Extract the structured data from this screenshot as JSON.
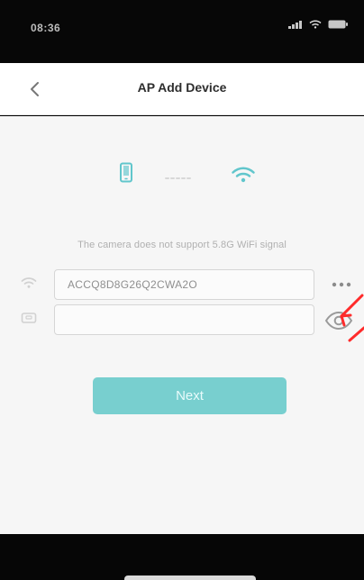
{
  "status_bar": {
    "time": "08:36",
    "location_icon": "location-arrow-icon",
    "signal_icon": "cellular-signal-icon",
    "wifi_icon": "wifi-icon",
    "battery_icon": "battery-icon"
  },
  "header": {
    "title": "AP Add Device",
    "back_icon": "chevron-left-icon"
  },
  "steps": {
    "icons": [
      "phone-icon",
      "dash-icon",
      "wifi-icon"
    ]
  },
  "form": {
    "notice": "The camera does not support 5.8G WiFi signal",
    "wifi_name": {
      "value": "ACCQ8D8G26Q2CWA2O",
      "icon": "wifi-icon",
      "more_icon": "more-dots-icon"
    },
    "password": {
      "value": "",
      "icon": "lock-box-icon",
      "eye_icon": "eye-icon"
    },
    "next_label": "Next"
  },
  "colors": {
    "accent": "#78cfcf",
    "arrow": "#ff2b2b",
    "text_muted": "#b0b0b0"
  }
}
